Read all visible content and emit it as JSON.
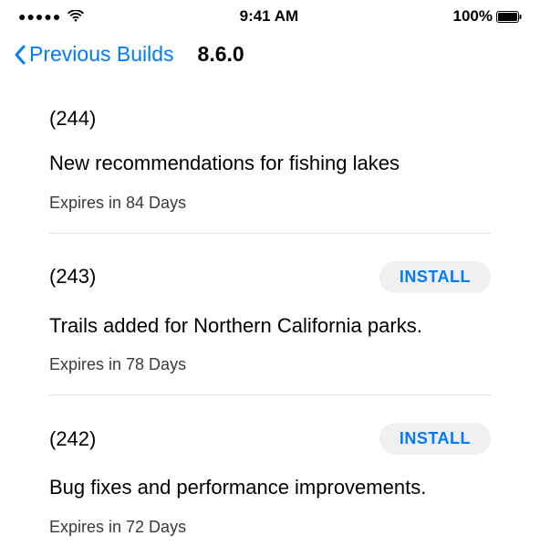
{
  "status_bar": {
    "time": "9:41 AM",
    "battery_percent": "100%"
  },
  "nav": {
    "back_label": "Previous Builds",
    "title": "8.6.0"
  },
  "install_label": "INSTALL",
  "builds": [
    {
      "number": "(244)",
      "desc": "New recommendations for fishing lakes",
      "expires": "Expires in 84 Days",
      "installable": false
    },
    {
      "number": "(243)",
      "desc": "Trails added for Northern California parks.",
      "expires": "Expires in 78 Days",
      "installable": true
    },
    {
      "number": "(242)",
      "desc": "Bug fixes and performance improvements.",
      "expires": "Expires in 72 Days",
      "installable": true
    }
  ]
}
